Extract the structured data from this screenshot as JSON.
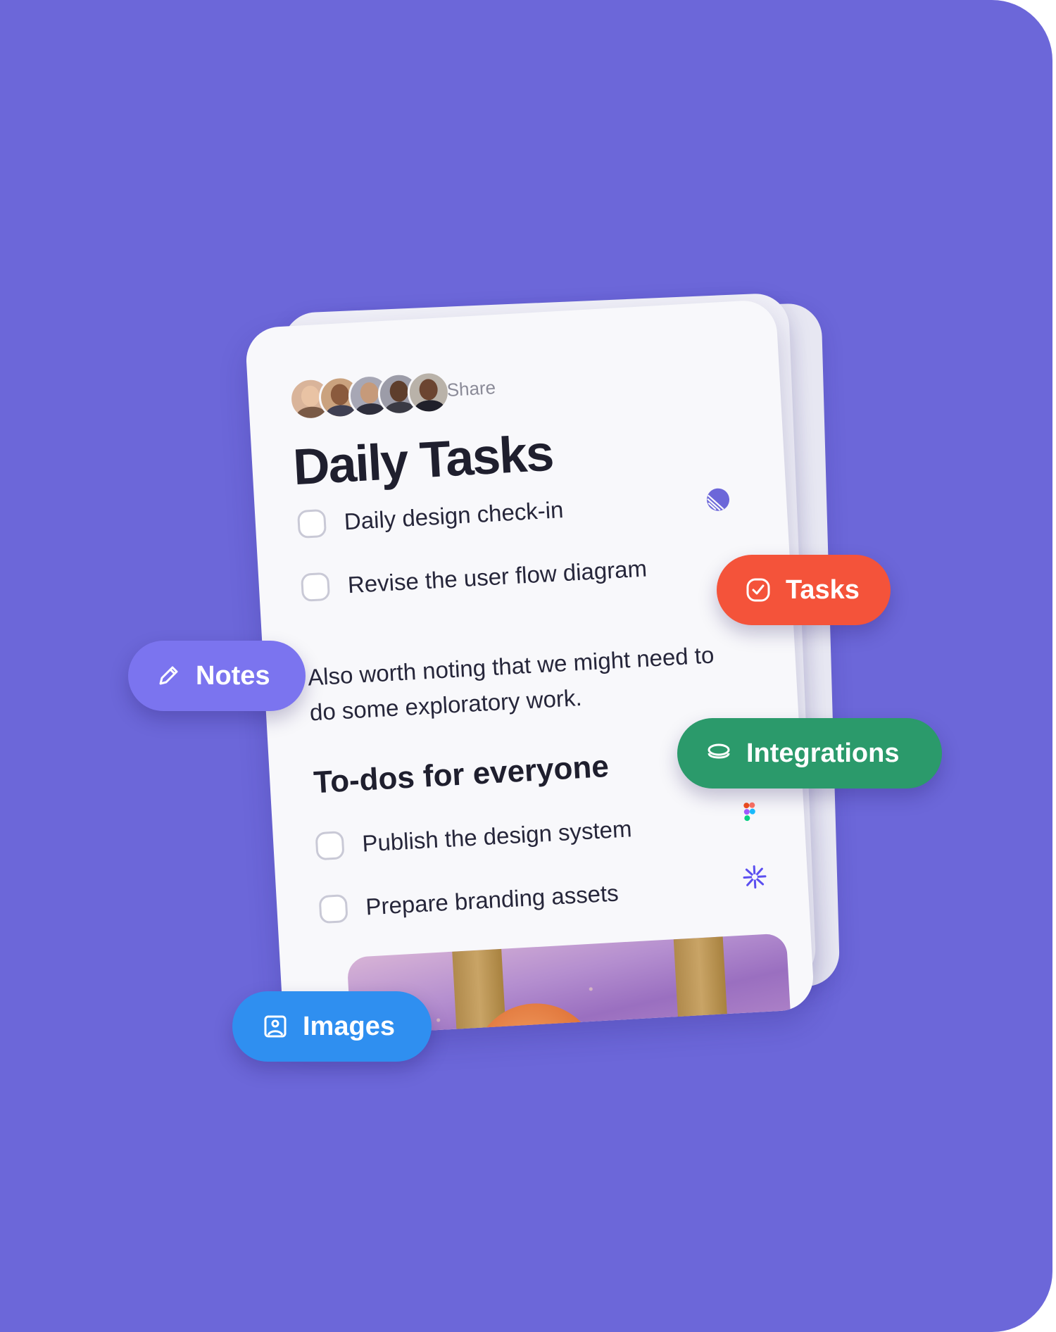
{
  "card": {
    "share_label": "Share",
    "title": "Daily Tasks",
    "tasks": [
      {
        "label": "Daily design check-in",
        "checked": false,
        "app_icon": "linear-logo-icon"
      },
      {
        "label": "Revise the user flow diagram",
        "checked": false
      }
    ],
    "note": "Also worth noting that we might need to do some exploratory work.",
    "subheading": "To-dos for everyone",
    "todos": [
      {
        "label": "Publish the design system",
        "checked": false,
        "app_icon": "figma-logo-icon"
      },
      {
        "label": "Prepare branding assets",
        "checked": false,
        "app_icon": "sparkle-logo-icon"
      }
    ],
    "avatars": [
      {
        "name": "avatar-1"
      },
      {
        "name": "avatar-2"
      },
      {
        "name": "avatar-3"
      },
      {
        "name": "avatar-4"
      },
      {
        "name": "avatar-5"
      }
    ]
  },
  "pills": {
    "notes": {
      "label": "Notes",
      "icon": "pencil-icon",
      "color": "#7b74ef"
    },
    "tasks": {
      "label": "Tasks",
      "icon": "check-circle-icon",
      "color": "#f4533a"
    },
    "integrations": {
      "label": "Integrations",
      "icon": "layers-icon",
      "color": "#2b9a6b"
    },
    "images": {
      "label": "Images",
      "icon": "image-icon",
      "color": "#2f8ff0"
    }
  },
  "colors": {
    "background": "#6c67d9",
    "card": "#f8f8fb"
  }
}
